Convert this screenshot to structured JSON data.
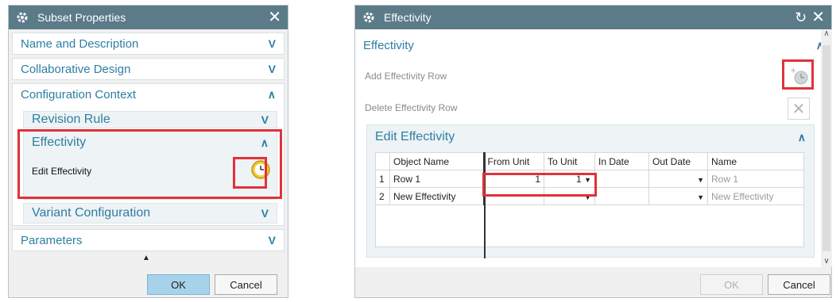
{
  "left": {
    "title": "Subset Properties",
    "sections": {
      "name_desc": "Name and Description",
      "collab": "Collaborative Design",
      "config": "Configuration Context",
      "revision": "Revision Rule",
      "effectivity": "Effectivity",
      "edit_effectivity": "Edit Effectivity",
      "variant": "Variant Configuration",
      "parameters": "Parameters"
    },
    "buttons": {
      "ok": "OK",
      "cancel": "Cancel"
    }
  },
  "right": {
    "title": "Effectivity",
    "section": "Effectivity",
    "add_row": "Add Effectivity Row",
    "delete_row": "Delete Effectivity Row",
    "edit_section": "Edit Effectivity",
    "table": {
      "headers": [
        "",
        "Object Name",
        "From Unit",
        "To Unit",
        "In Date",
        "Out Date",
        "Name"
      ],
      "rows": [
        {
          "num": "1",
          "object": "Row 1",
          "from": "1",
          "to": "1",
          "in": "",
          "out": "",
          "name": "Row 1"
        },
        {
          "num": "2",
          "object": "New Effectivity",
          "from": "",
          "to": "",
          "in": "",
          "out": "",
          "name": "New Effectivity"
        }
      ]
    },
    "buttons": {
      "ok": "OK",
      "cancel": "Cancel"
    }
  },
  "colors": {
    "titlebar": "#5b7b89",
    "accent": "#2e7ea3",
    "highlight": "#e0323a",
    "ok_button": "#a6d3ea"
  }
}
